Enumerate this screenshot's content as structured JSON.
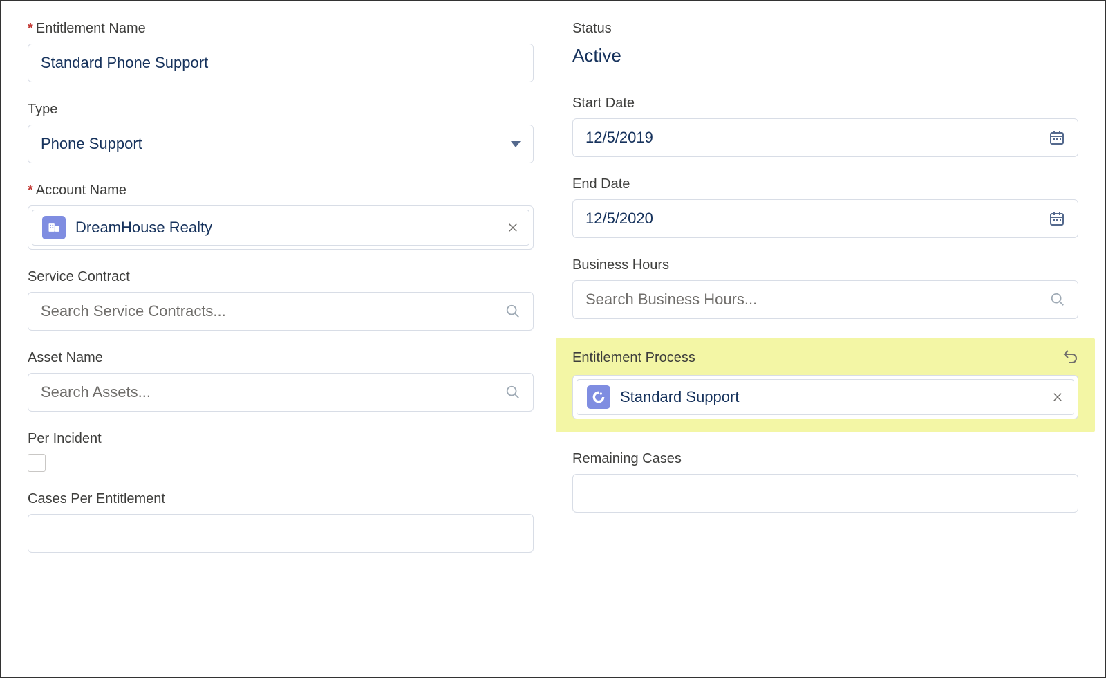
{
  "left": {
    "entitlement_name": {
      "label": "Entitlement Name",
      "value": "Standard Phone Support"
    },
    "type": {
      "label": "Type",
      "value": "Phone Support"
    },
    "account_name": {
      "label": "Account Name",
      "value": "DreamHouse Realty"
    },
    "service_contract": {
      "label": "Service Contract",
      "placeholder": "Search Service Contracts..."
    },
    "asset_name": {
      "label": "Asset Name",
      "placeholder": "Search Assets..."
    },
    "per_incident": {
      "label": "Per Incident"
    },
    "cases_per_entitlement": {
      "label": "Cases Per Entitlement",
      "value": ""
    }
  },
  "right": {
    "status": {
      "label": "Status",
      "value": "Active"
    },
    "start_date": {
      "label": "Start Date",
      "value": "12/5/2019"
    },
    "end_date": {
      "label": "End Date",
      "value": "12/5/2020"
    },
    "business_hours": {
      "label": "Business Hours",
      "placeholder": "Search Business Hours..."
    },
    "entitlement_process": {
      "label": "Entitlement Process",
      "value": "Standard Support"
    },
    "remaining_cases": {
      "label": "Remaining Cases",
      "value": ""
    }
  },
  "icons": {
    "account": "account-icon",
    "entitlement_process": "entitlement-process-icon"
  }
}
